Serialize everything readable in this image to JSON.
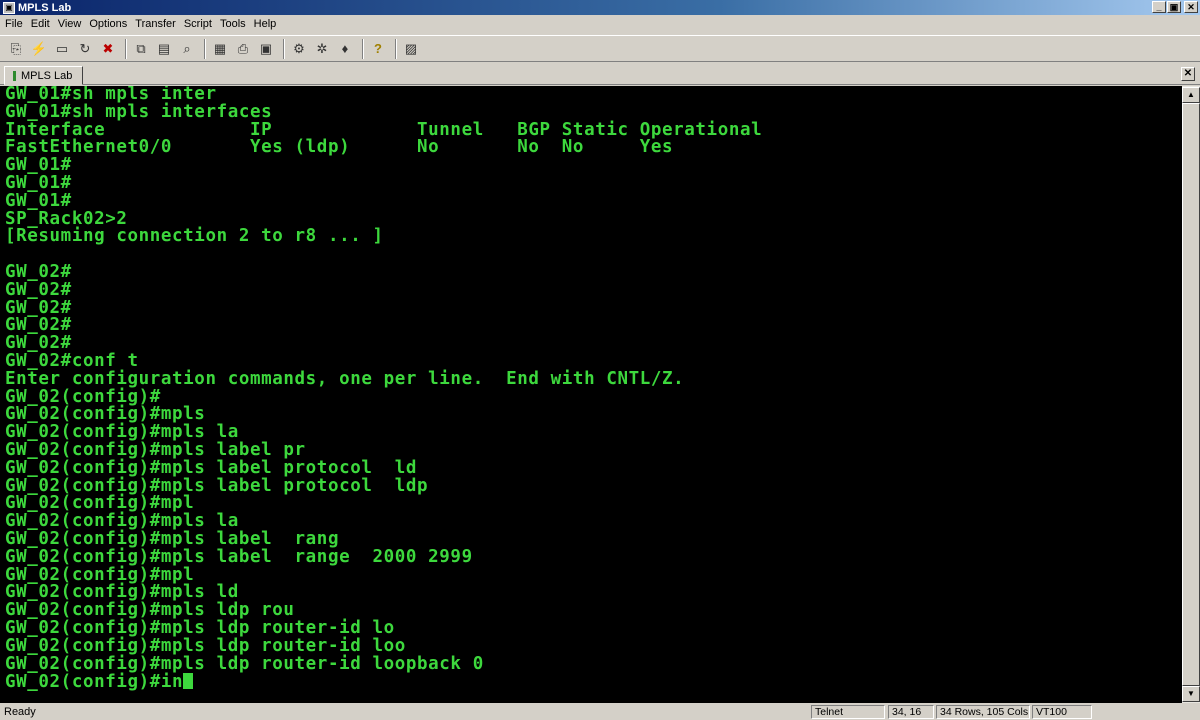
{
  "window": {
    "title": "MPLS Lab",
    "minimize_label": "_",
    "maximize_label": "▣",
    "close_label": "✕"
  },
  "menu": [
    "File",
    "Edit",
    "View",
    "Options",
    "Transfer",
    "Script",
    "Tools",
    "Help"
  ],
  "toolbar": {
    "icons": [
      "connect-icon",
      "quick-connect-icon",
      "connect-in-tab-icon",
      "reconnect-icon",
      "disconnect-icon",
      "copy-icon",
      "paste-icon",
      "find-icon",
      "print-setup-icon",
      "print-icon",
      "print-screen-icon",
      "session-options-icon",
      "global-options-icon",
      "keymap-icon",
      "help-icon",
      "sftp-icon"
    ]
  },
  "tab": {
    "label": "MPLS Lab",
    "close_label": "✕"
  },
  "terminal": {
    "lines": [
      "GW_01#sh mpls inter",
      "GW_01#sh mpls interfaces",
      "Interface             IP             Tunnel   BGP Static Operational",
      "FastEthernet0/0       Yes (ldp)      No       No  No     Yes",
      "GW_01#",
      "GW_01#",
      "GW_01#",
      "SP_Rack02>2",
      "[Resuming connection 2 to r8 ... ]",
      "",
      "GW_02#",
      "GW_02#",
      "GW_02#",
      "GW_02#",
      "GW_02#",
      "GW_02#conf t",
      "Enter configuration commands, one per line.  End with CNTL/Z.",
      "GW_02(config)#",
      "GW_02(config)#mpls",
      "GW_02(config)#mpls la",
      "GW_02(config)#mpls label pr",
      "GW_02(config)#mpls label protocol  ld",
      "GW_02(config)#mpls label protocol  ldp",
      "GW_02(config)#mpl",
      "GW_02(config)#mpls la",
      "GW_02(config)#mpls label  rang",
      "GW_02(config)#mpls label  range  2000 2999",
      "GW_02(config)#mpl",
      "GW_02(config)#mpls ld",
      "GW_02(config)#mpls ldp rou",
      "GW_02(config)#mpls ldp router-id lo",
      "GW_02(config)#mpls ldp router-id loo",
      "GW_02(config)#mpls ldp router-id loopback 0",
      "GW_02(config)#in"
    ]
  },
  "scrollbar": {
    "up_label": "▲",
    "down_label": "▼"
  },
  "status": {
    "ready": "Ready",
    "protocol": "Telnet",
    "cursor_pos": "34, 16",
    "dimensions": "34 Rows, 105 Cols",
    "emulation": "VT100"
  }
}
